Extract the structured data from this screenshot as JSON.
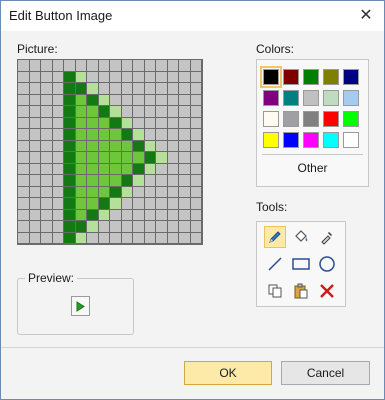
{
  "window": {
    "title": "Edit Button Image",
    "close_symbol": "✕"
  },
  "picture": {
    "label": "Picture:",
    "size": 16,
    "palette": {
      "g": "#c4c4c4",
      "D": "#137a13",
      "B": "#6ec63a",
      "L": "#b5e09a"
    },
    "rows": [
      "gggggggggggggggg",
      "ggggDLgggggggggg",
      "ggggDDLggggggggg",
      "ggggDBDLgggggggg",
      "ggggDBBDLggggggg",
      "ggggDBBBDLgggggg",
      "ggggDBBBBDLggggg",
      "ggggDBBBBBDLgggg",
      "ggggDBBBBBBDLggg",
      "ggggDBBBBBDLgggg",
      "ggggDBBBBDLggggg",
      "ggggDBBBDLgggggg",
      "ggggDBBDLggggggg",
      "ggggDBDLgggggggg",
      "ggggDDLggggggggg",
      "ggggDLgggggggggg"
    ]
  },
  "colors": {
    "label": "Colors:",
    "selected_index": 0,
    "swatches": [
      "#000000",
      "#800000",
      "#008000",
      "#808000",
      "#000080",
      "#800080",
      "#008080",
      "#c0c0c0",
      "#c0dcc0",
      "#a6caf0",
      "#fffbf0",
      "#a0a0a4",
      "#808080",
      "#ff0000",
      "#00ff00",
      "#ffff00",
      "#0000ff",
      "#ff00ff",
      "#00ffff",
      "#ffffff"
    ],
    "other_label": "Other"
  },
  "tools": {
    "label": "Tools:",
    "items": [
      {
        "name": "pencil-icon",
        "active": true
      },
      {
        "name": "fill-bucket-icon",
        "active": false
      },
      {
        "name": "eyedropper-icon",
        "active": false
      },
      {
        "name": "line-icon",
        "active": false
      },
      {
        "name": "rectangle-icon",
        "active": false
      },
      {
        "name": "ellipse-icon",
        "active": false
      },
      {
        "name": "copy-icon",
        "active": false
      },
      {
        "name": "paste-icon",
        "active": false
      },
      {
        "name": "delete-icon",
        "active": false
      }
    ]
  },
  "preview": {
    "label": "Preview:",
    "icon": "play-arrow-icon"
  },
  "buttons": {
    "ok": "OK",
    "cancel": "Cancel"
  }
}
